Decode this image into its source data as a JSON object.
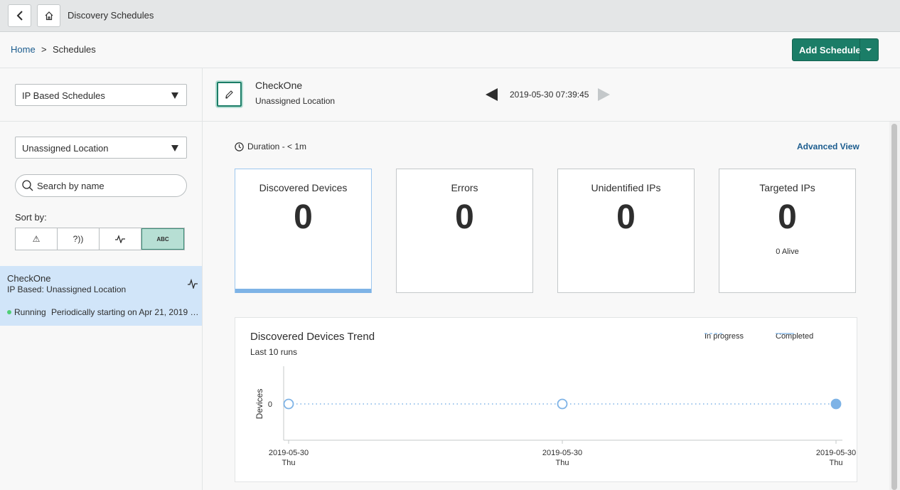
{
  "topbar": {
    "title": "Discovery Schedules",
    "back_icon": "chevron-left-icon",
    "home_icon": "home-icon"
  },
  "breadcrumb": {
    "home": "Home",
    "separator": ">",
    "current": "Schedules"
  },
  "add_schedule": {
    "label": "Add Schedule"
  },
  "sidebar": {
    "schedule_type": "IP Based Schedules",
    "location": "Unassigned Location",
    "search_placeholder": "Search by name",
    "sort_label": "Sort by:",
    "sort_options": [
      {
        "icon": "warning-icon",
        "text": "⚠"
      },
      {
        "icon": "unknown-signal-icon",
        "text": "?))"
      },
      {
        "icon": "pulse-icon",
        "text": ""
      },
      {
        "icon": "abc-icon",
        "text": "ABC"
      }
    ],
    "active_sort_index": 3,
    "schedule": {
      "name": "CheckOne",
      "subtitle": "IP Based: Unassigned Location",
      "status": "Running",
      "period": "Periodically starting on Apr 21, 2019 @..."
    }
  },
  "header": {
    "name": "CheckOne",
    "location": "Unassigned Location",
    "timestamp": "2019-05-30 07:39:45"
  },
  "main": {
    "duration": "Duration - < 1m",
    "advanced_view": "Advanced View",
    "cards": [
      {
        "title": "Discovered Devices",
        "value": "0",
        "extra": ""
      },
      {
        "title": "Errors",
        "value": "0",
        "extra": ""
      },
      {
        "title": "Unidentified IPs",
        "value": "0",
        "extra": ""
      },
      {
        "title": "Targeted IPs",
        "value": "0",
        "extra": "0 Alive"
      }
    ],
    "selected_card_index": 0
  },
  "colors": {
    "accent": "#1b7d67",
    "link": "#1b5c8e",
    "chart_line": "#7eb3e6",
    "selected_row": "#d1e5f9",
    "running": "#4fcf76"
  },
  "chart_data": {
    "type": "line",
    "title": "Discovered Devices Trend",
    "subtitle": "Last 10 runs",
    "ylabel": "Devices",
    "legend": [
      "In progress",
      "Completed"
    ],
    "legend_position": "top-right",
    "y_ticks": [
      "0"
    ],
    "x": [
      {
        "date": "2019-05-30",
        "day": "Thu"
      },
      {
        "date": "2019-05-30",
        "day": "Thu"
      },
      {
        "date": "2019-05-30",
        "day": "Thu"
      }
    ],
    "series": [
      {
        "name": "In progress",
        "values": [
          0,
          0,
          0
        ],
        "filled": [
          false,
          false,
          true
        ]
      }
    ]
  }
}
